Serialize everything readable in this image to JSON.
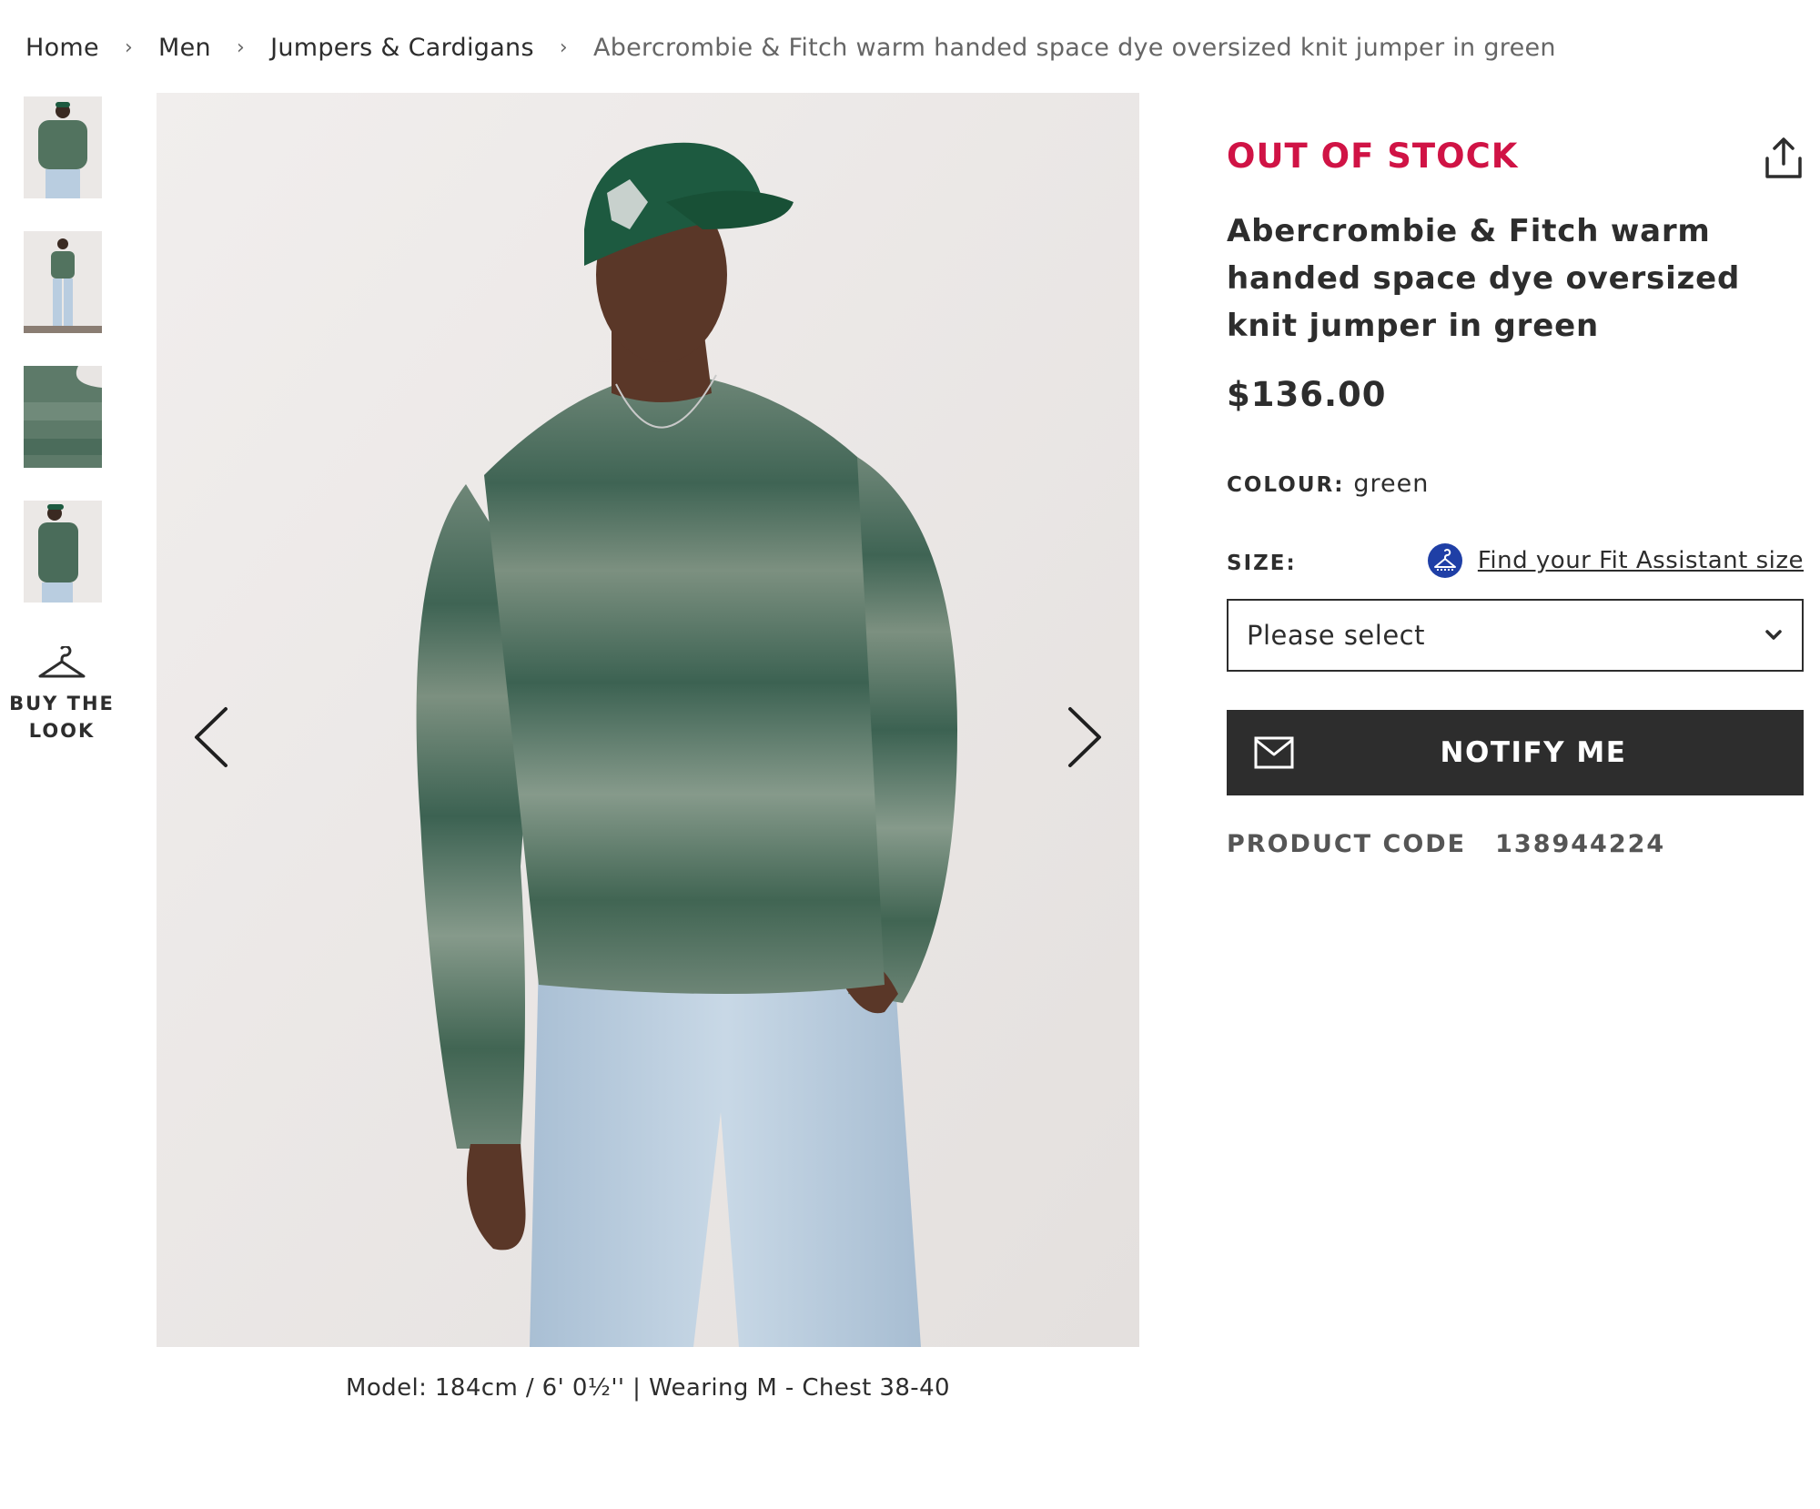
{
  "breadcrumb": {
    "home": "Home",
    "men": "Men",
    "category": "Jumpers & Cardigans",
    "current": "Abercrombie & Fitch warm handed space dye oversized knit jumper in green",
    "separator": "›"
  },
  "gallery": {
    "thumbnails": [
      "thumbnail-1",
      "thumbnail-2",
      "thumbnail-3",
      "thumbnail-4"
    ],
    "buy_the_look": "BUY THE\nLOOK",
    "caption": "Model: 184cm / 6' 0½'' | Wearing M - Chest 38-40"
  },
  "product": {
    "stock_status": "OUT OF STOCK",
    "title": "Abercrombie & Fitch warm handed space dye oversized knit jumper in green",
    "price": "$136.00",
    "colour_label": "COLOUR:",
    "colour_value": "green",
    "size_label": "SIZE:",
    "fit_assistant_link": "Find your Fit Assistant size",
    "size_select_value": "Please select",
    "notify_button": "NOTIFY ME",
    "product_code_label": "PRODUCT CODE",
    "product_code": "138944224"
  },
  "colors": {
    "stock_red": "#d01345",
    "text_dark": "#2d2d2d",
    "button_dark": "#2d2d2d",
    "sweater_green": "#466b5b",
    "cap_green": "#1d5a40",
    "jeans_blue": "#b9cde0",
    "fit_icon_blue": "#1f3fa6"
  },
  "icons": {
    "share": "share-icon",
    "prev": "chevron-left-icon",
    "next": "chevron-right-icon",
    "dropdown": "chevron-down-icon",
    "mail": "mail-icon",
    "hanger": "hanger-icon",
    "fit": "fit-assistant-icon"
  }
}
